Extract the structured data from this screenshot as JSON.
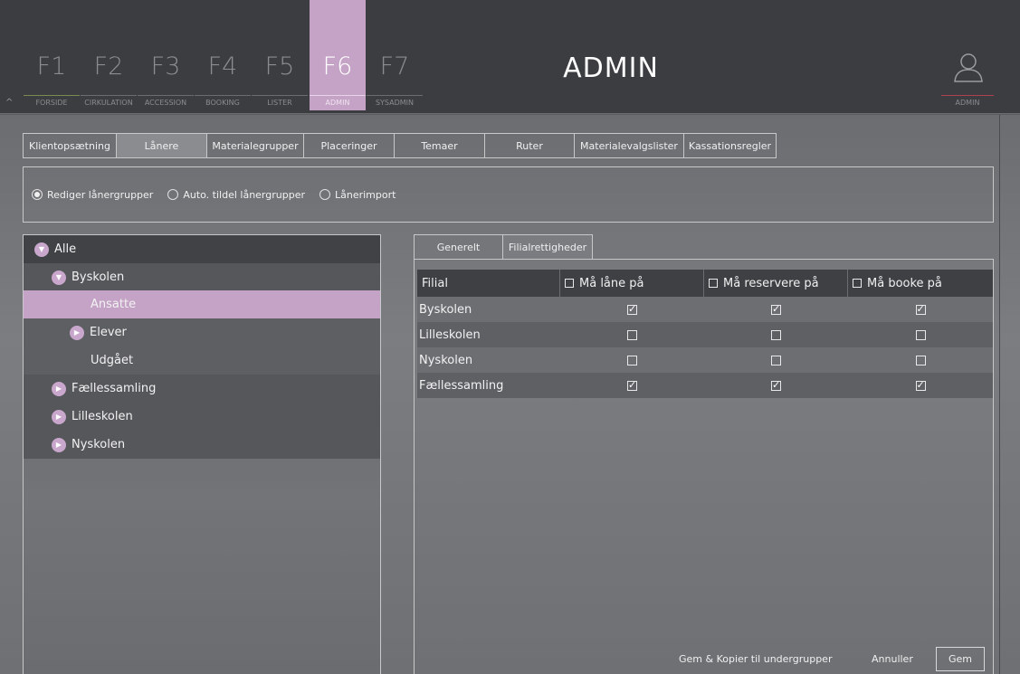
{
  "header": {
    "fkeys": [
      {
        "key": "F1",
        "label": "FORSIDE"
      },
      {
        "key": "F2",
        "label": "CIRKULATION"
      },
      {
        "key": "F3",
        "label": "ACCESSION"
      },
      {
        "key": "F4",
        "label": "BOOKING"
      },
      {
        "key": "F5",
        "label": "LISTER"
      },
      {
        "key": "F6",
        "label": "ADMIN"
      },
      {
        "key": "F7",
        "label": "SYSADMIN"
      }
    ],
    "active_fkey": "F6",
    "title": "ADMIN",
    "user_label": "ADMIN",
    "collapse_glyph": "^"
  },
  "tabs": [
    {
      "label": "Klientopsætning"
    },
    {
      "label": "Lånere",
      "selected": true
    },
    {
      "label": "Materialegrupper"
    },
    {
      "label": "Placeringer"
    },
    {
      "label": "Temaer"
    },
    {
      "label": "Ruter"
    },
    {
      "label": "Materialevalgslister"
    },
    {
      "label": "Kassationsregler"
    }
  ],
  "radios": [
    {
      "label": "Rediger lånergrupper",
      "checked": true
    },
    {
      "label": "Auto. tildel lånergrupper",
      "checked": false
    },
    {
      "label": "Lånerimport",
      "checked": false
    }
  ],
  "tree": [
    {
      "label": "Alle",
      "toggle": "expanded"
    },
    {
      "label": "Byskolen",
      "toggle": "expanded"
    },
    {
      "label": "Ansatte",
      "toggle": "none",
      "selected": true
    },
    {
      "label": "Elever",
      "toggle": "collapsed"
    },
    {
      "label": "Udgået",
      "toggle": "none"
    },
    {
      "label": "Fællessamling",
      "toggle": "collapsed"
    },
    {
      "label": "Lilleskolen",
      "toggle": "collapsed"
    },
    {
      "label": "Nyskolen",
      "toggle": "collapsed"
    }
  ],
  "right_tabs": [
    {
      "label": "Generelt"
    },
    {
      "label": "Filialrettigheder",
      "selected": true
    }
  ],
  "grid": {
    "columns": [
      "Filial",
      "Må låne på",
      "Må reservere på",
      "Må booke på"
    ],
    "rows": [
      {
        "name": "Byskolen",
        "laane": true,
        "reservere": true,
        "booke": true
      },
      {
        "name": "Lilleskolen",
        "laane": false,
        "reservere": false,
        "booke": false
      },
      {
        "name": "Nyskolen",
        "laane": false,
        "reservere": false,
        "booke": false
      },
      {
        "name": "Fællessamling",
        "laane": true,
        "reservere": true,
        "booke": true
      }
    ]
  },
  "buttons": {
    "copy_label": "Gem & Kopier til undergrupper",
    "cancel_label": "Annuller",
    "save_label": "Gem"
  },
  "colors": {
    "accent": "#c5a3c6",
    "header_bg": "#3b3d41",
    "user_line": "#b04050"
  }
}
